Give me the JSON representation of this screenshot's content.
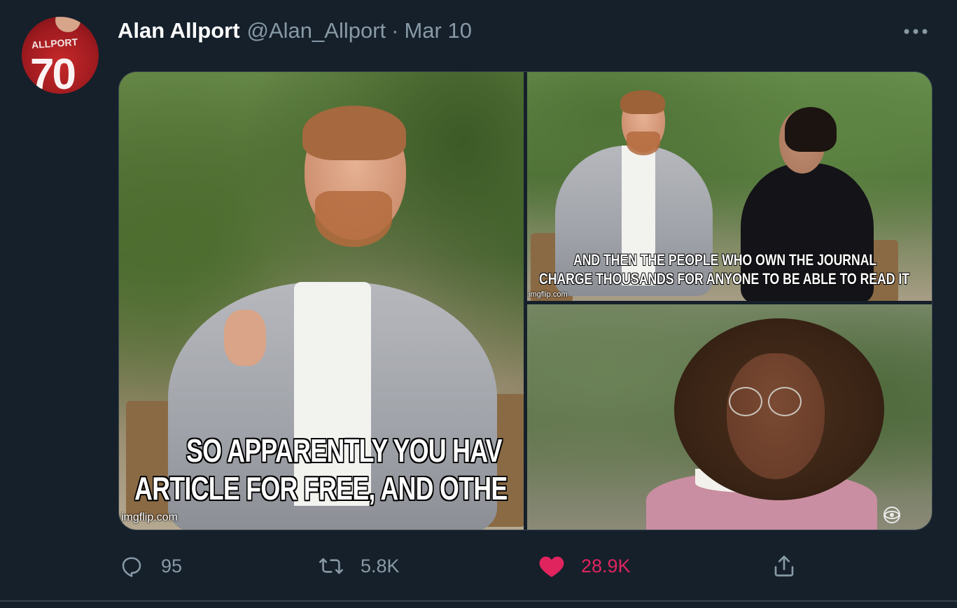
{
  "tweet": {
    "author": {
      "display_name": "Alan Allport",
      "handle": "@Alan_Allport",
      "avatar_icon": "avatar-shirt-icon",
      "avatar_shirt_name": "ALLPORT",
      "avatar_shirt_number": "70"
    },
    "separator": "·",
    "date": "Mar 10",
    "more_icon": "more-horizontal-icon",
    "media": {
      "left": {
        "caption_line1": "SO APPARENTLY YOU HAV",
        "caption_line2": "ARTICLE FOR FREE, AND OTHE",
        "watermark": "imgflip.com"
      },
      "top_right": {
        "caption_line1": "AND THEN THE PEOPLE WHO OWN THE JOURNAL",
        "caption_line2": "CHARGE THOUSANDS FOR ANYONE TO BE ABLE TO READ IT",
        "watermark": "imgflip.com"
      },
      "bottom_right": {
        "logo_icon": "cbs-eye-icon"
      }
    },
    "actions": {
      "reply": {
        "icon": "reply-icon",
        "count": "95"
      },
      "retweet": {
        "icon": "retweet-icon",
        "count": "5.8K"
      },
      "like": {
        "icon": "heart-icon",
        "count": "28.9K",
        "liked": true,
        "color": "#e0245e"
      },
      "share": {
        "icon": "share-icon"
      }
    }
  },
  "colors": {
    "background": "#15202b",
    "secondary_text": "#8899a6",
    "divider": "#38444d",
    "like": "#e0245e"
  }
}
